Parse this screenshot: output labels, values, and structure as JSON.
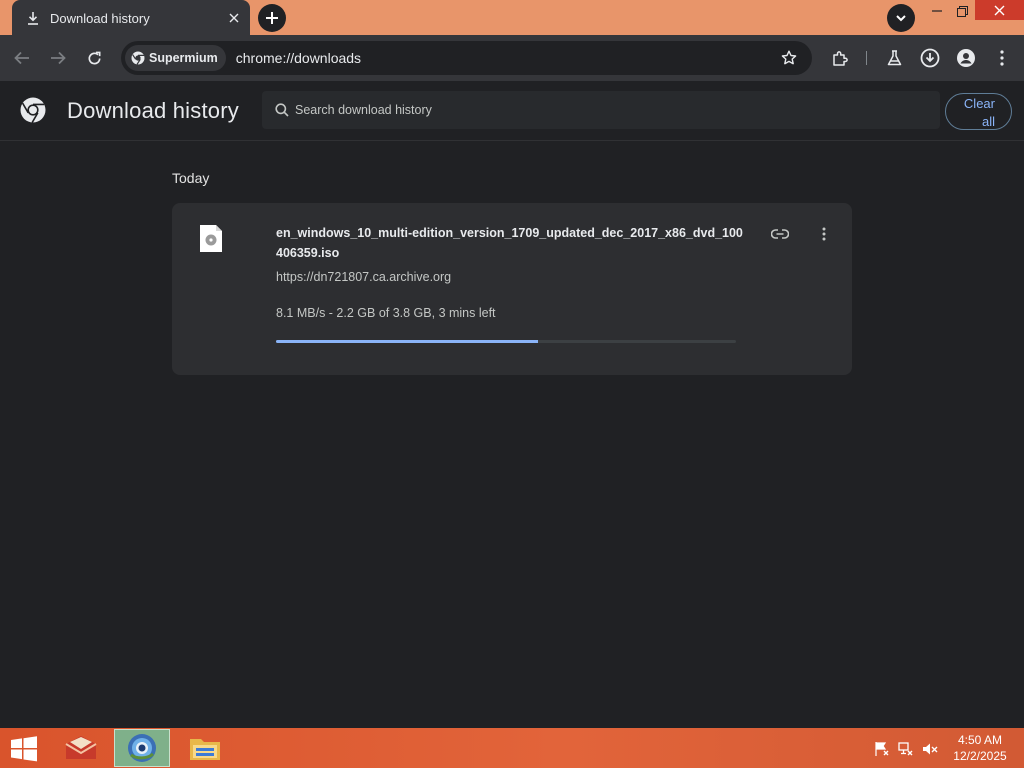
{
  "browser": {
    "tab": {
      "title": "Download history",
      "icon": "download-icon"
    },
    "toolbar": {
      "site_chip_label": "Supermium",
      "url": "chrome://downloads"
    }
  },
  "page": {
    "title": "Download history",
    "search_placeholder": "Search download history",
    "clear_all_label_line1": "Clear",
    "clear_all_label_line2": "all"
  },
  "downloads": {
    "section": "Today",
    "items": [
      {
        "filename": "en_windows_10_multi-edition_version_1709_updated_dec_2017_x86_dvd_100406359.iso",
        "url": "https://dn721807.ca.archive.org",
        "status": "8.1 MB/s - 2.2 GB of 3.8 GB, 3 mins left",
        "progress_fraction": 0.57
      }
    ]
  },
  "taskbar": {
    "time": "4:50 AM",
    "date": "12/2/2025"
  },
  "colors": {
    "accent": "#8ab4f8",
    "tabstrip": "#e8956a",
    "taskbar": "#e2643a"
  }
}
